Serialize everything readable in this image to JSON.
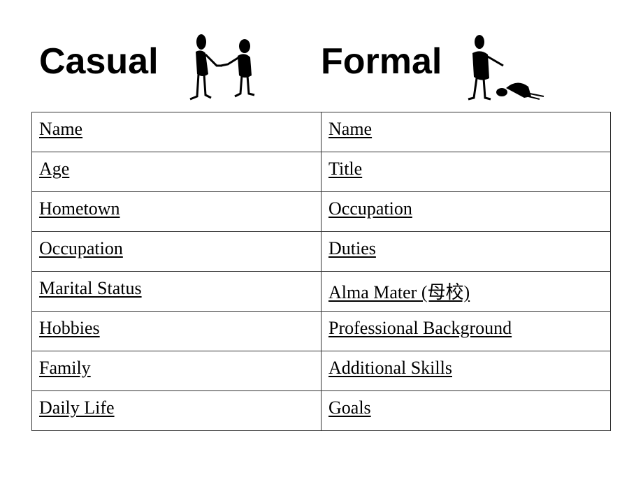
{
  "headings": {
    "casual": "Casual",
    "formal": "Formal"
  },
  "illustrations": {
    "casual": "handshake-figures",
    "formal": "bowing-figures"
  },
  "table": {
    "rows": [
      {
        "casual": "Name",
        "formal": "Name "
      },
      {
        "casual": "Age",
        "formal": "Title"
      },
      {
        "casual": "Hometown",
        "formal": "Occupation"
      },
      {
        "casual": "Occupation",
        "formal": "Duties"
      },
      {
        "casual": "Marital Status",
        "formal": "Alma Mater (母校)"
      },
      {
        "casual": "Hobbies",
        "formal": "Professional Background"
      },
      {
        "casual": "Family",
        "formal": "Additional Skills"
      },
      {
        "casual": "Daily Life",
        "formal": "Goals"
      }
    ]
  }
}
